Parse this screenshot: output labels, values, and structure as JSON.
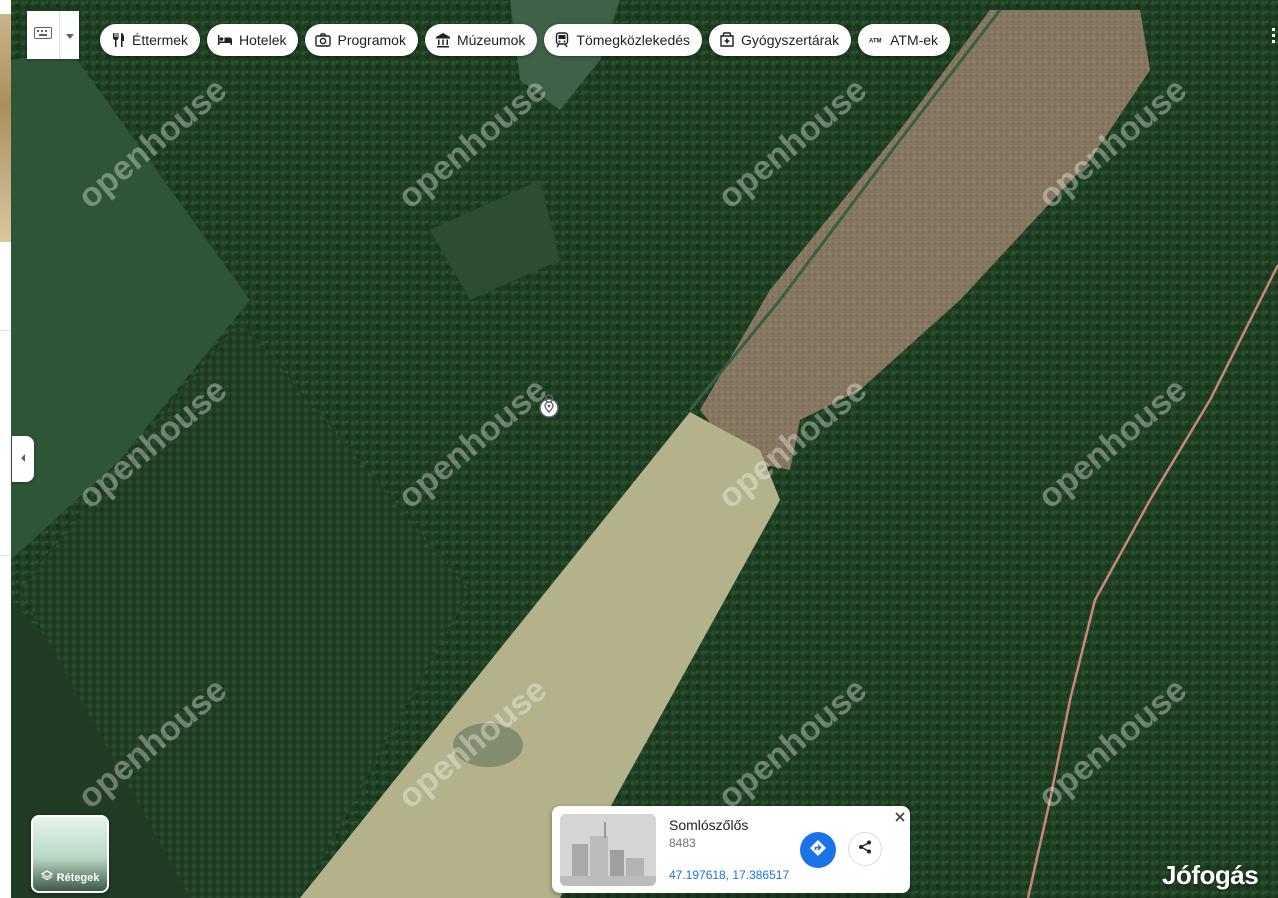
{
  "map": {
    "watermark": "openhouse",
    "colors": {
      "forest": "#203f24",
      "field_light": "#b4b48d",
      "field_brown": "#8a7a61",
      "meadow": "#2f5637",
      "road": "#c9867a"
    }
  },
  "categories": [
    {
      "label": "Éttermek",
      "icon": "utensils-icon"
    },
    {
      "label": "Hotelek",
      "icon": "bed-icon"
    },
    {
      "label": "Programok",
      "icon": "camera-icon"
    },
    {
      "label": "Múzeumok",
      "icon": "museum-icon"
    },
    {
      "label": "Tömegközlekedés",
      "icon": "train-icon"
    },
    {
      "label": "Gyógyszertárak",
      "icon": "pharmacy-icon"
    },
    {
      "label": "ATM-ek",
      "icon": "atm-icon"
    }
  ],
  "layers": {
    "label": "Rétegek"
  },
  "place_card": {
    "title": "Somlószőlős",
    "zip": "8483",
    "coords": "47.197618, 17.386517"
  },
  "brand": "Jófogás",
  "accent_color": "#1a73e8"
}
